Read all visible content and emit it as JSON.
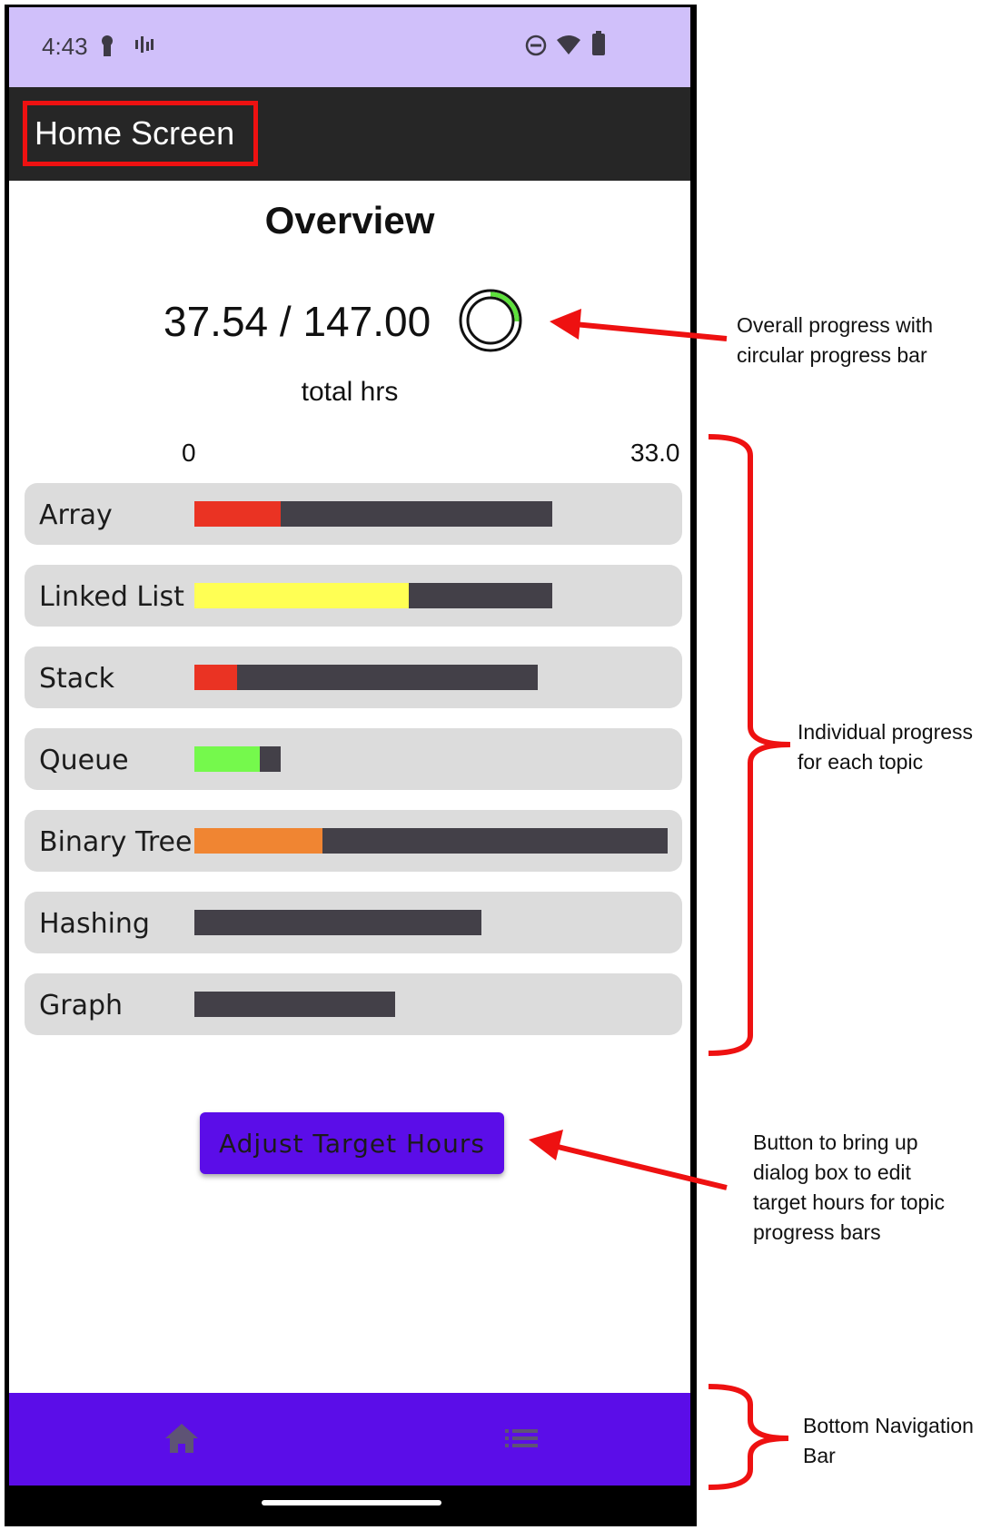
{
  "status_bar": {
    "time": "4:43"
  },
  "app_bar": {
    "title": "Home Screen"
  },
  "overview": {
    "title": "Overview",
    "value": "37.54 / 147.00",
    "unit": "total hrs",
    "progress_fraction": 0.255
  },
  "scale": {
    "min": "0",
    "max": "33.0"
  },
  "topics": [
    {
      "label": "Array",
      "target_fraction": 0.757,
      "progress_fraction": 0.24,
      "color": "#ea3323"
    },
    {
      "label": "Linked List",
      "target_fraction": 0.757,
      "progress_fraction": 0.6,
      "color": "#ffff54"
    },
    {
      "label": "Stack",
      "target_fraction": 0.726,
      "progress_fraction": 0.124,
      "color": "#ea3323"
    },
    {
      "label": "Queue",
      "target_fraction": 0.182,
      "progress_fraction": 0.76,
      "color": "#75f94c"
    },
    {
      "label": "Binary Tree",
      "target_fraction": 1.0,
      "progress_fraction": 0.27,
      "color": "#f08532"
    },
    {
      "label": "Hashing",
      "target_fraction": 0.606,
      "progress_fraction": 0.0,
      "color": "#434048"
    },
    {
      "label": "Graph",
      "target_fraction": 0.424,
      "progress_fraction": 0.0,
      "color": "#434048"
    }
  ],
  "adjust_button": {
    "label": "Adjust Target Hours"
  },
  "bottom_nav": {
    "items": [
      "home-icon",
      "list-icon"
    ]
  },
  "annotations": {
    "overall": [
      "Overall progress with",
      "circular progress bar"
    ],
    "topics": [
      "Individual progress",
      "for each topic"
    ],
    "button": [
      "Button to bring up",
      "dialog box to edit",
      "target hours for topic",
      "progress bars"
    ],
    "nav": [
      "Bottom Navigation",
      "Bar"
    ]
  },
  "colors": {
    "accent": "#5b0de8",
    "status_bar": "#d0c0fa",
    "app_bar": "#262626",
    "annotation": "#ee1111"
  }
}
